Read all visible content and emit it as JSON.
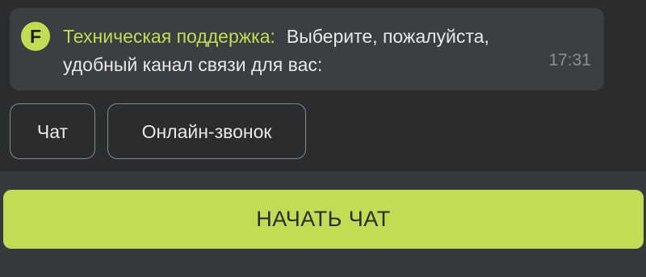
{
  "message": {
    "avatar_letter": "F",
    "sender": "Техническая поддержка",
    "sender_colon": ":",
    "text": "Выберите, пожалуйста, удобный канал связи для вас:",
    "time": "17:31"
  },
  "quick_replies": [
    {
      "label": "Чат"
    },
    {
      "label": "Онлайн-звонок"
    }
  ],
  "start_button": {
    "label": "НАЧАТЬ ЧАТ"
  },
  "colors": {
    "accent": "#c1dc55",
    "background": "#2a2c2e",
    "bubble": "#3c3f42",
    "panel": "#363a3d"
  }
}
